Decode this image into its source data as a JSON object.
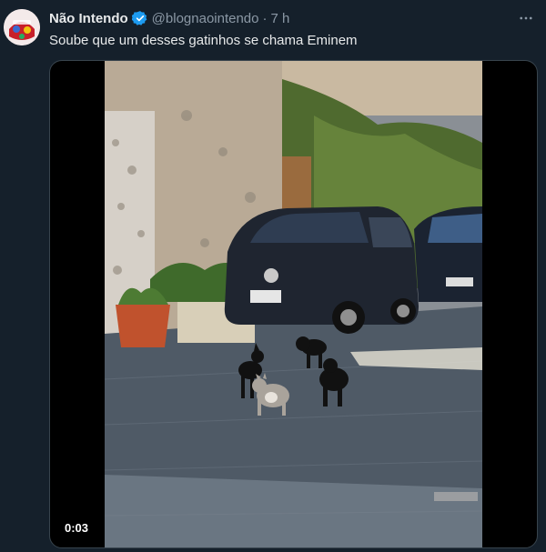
{
  "author": {
    "display_name": "Não Intendo",
    "handle": "@blognaointendo",
    "separator": "·",
    "time": "7 h",
    "verified": true
  },
  "tweet": {
    "text": "Soube que um desses gatinhos se chama Eminem"
  },
  "media": {
    "type": "video",
    "duration": "0:03"
  },
  "icons": {
    "verified": "verified-badge-icon",
    "more": "more-options-icon"
  },
  "colors": {
    "background": "#15202b",
    "verified_blue": "#1d9bf0",
    "muted_text": "#8b98a5"
  }
}
